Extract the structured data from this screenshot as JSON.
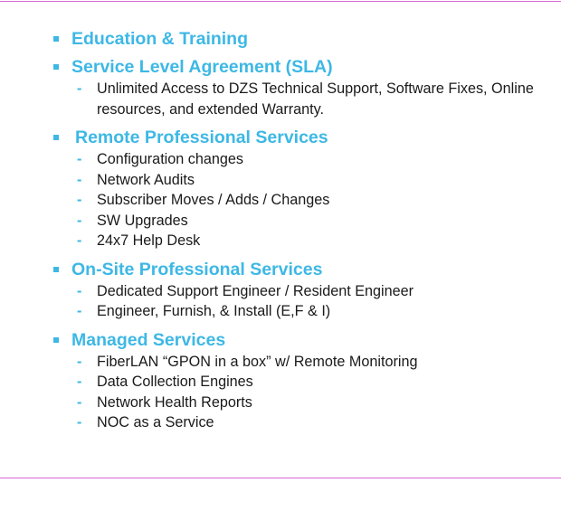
{
  "colors": {
    "heading": "#3DB8E5",
    "dash": "#3DB8E5",
    "rule": "#D667D6",
    "text": "#1a1a1a"
  },
  "sections": [
    {
      "title": "Education & Training",
      "items": []
    },
    {
      "title": "Service Level Agreement (SLA)",
      "items": [
        "Unlimited Access to DZS Technical Support, Software Fixes, Online resources, and extended Warranty."
      ]
    },
    {
      "title": "Remote Professional Services",
      "items": [
        "Configuration changes",
        "Network Audits",
        "Subscriber Moves / Adds / Changes",
        "SW Upgrades",
        "24x7 Help Desk"
      ]
    },
    {
      "title": "On-Site Professional Services",
      "items": [
        "Dedicated Support Engineer / Resident Engineer",
        "Engineer, Furnish, & Install (E,F & I)"
      ]
    },
    {
      "title": "Managed Services",
      "items": [
        "FiberLAN “GPON in a box” w/ Remote Monitoring",
        "Data Collection Engines",
        "Network Health Reports",
        "NOC as a Service"
      ]
    }
  ]
}
